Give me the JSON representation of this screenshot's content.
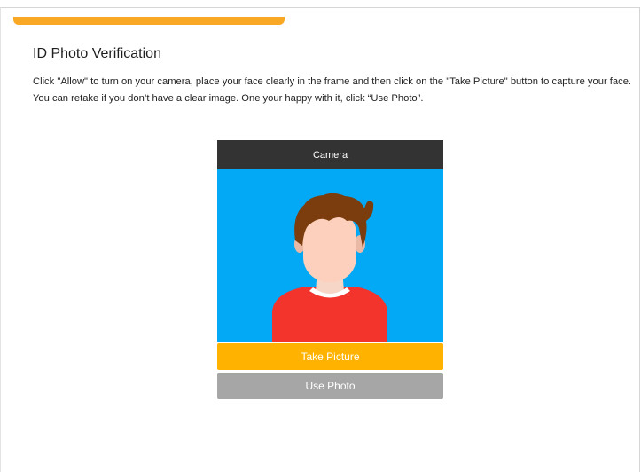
{
  "page": {
    "title": "ID Photo Verification",
    "instructions": "Click \"Allow\" to turn on your camera, place your face clearly in the frame and then click on the \"Take Picture\" button to capture your face. You can retake if you don’t have a clear image. One your happy with it, click “Use Photo”."
  },
  "camera": {
    "header": "Camera"
  },
  "buttons": {
    "take_picture": "Take Picture",
    "use_photo": "Use Photo"
  },
  "colors": {
    "progress": "#f9a825",
    "camera_background": "#03a9f4",
    "camera_header": "#333333",
    "take_picture": "#ffb300",
    "use_photo": "#a6a6a6"
  },
  "progress": {
    "fraction": 0.42
  }
}
